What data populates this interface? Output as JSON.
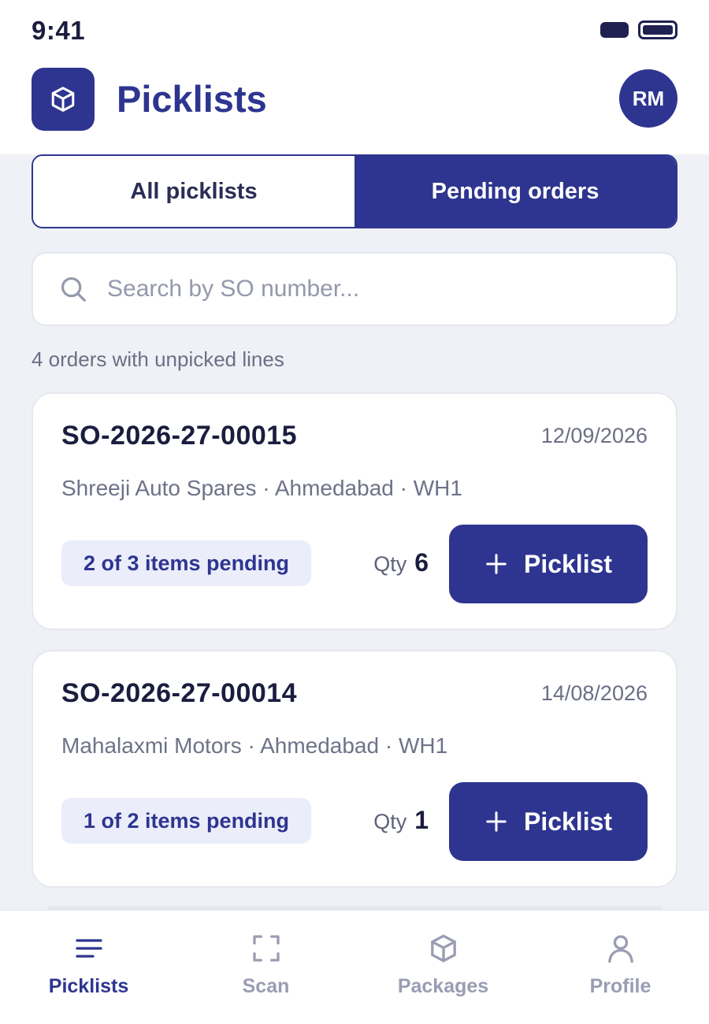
{
  "status_bar": {
    "time": "9:41"
  },
  "header": {
    "title": "Picklists",
    "logo_icon": "package-icon",
    "avatar_initials": "RM"
  },
  "tabs": [
    {
      "label": "All picklists",
      "active": false
    },
    {
      "label": "Pending orders",
      "active": true
    }
  ],
  "search": {
    "placeholder": "Search by SO number...",
    "value": ""
  },
  "summary": {
    "label": "4 orders with unpicked lines"
  },
  "orders": [
    {
      "so_number": "SO-2026-27-00015",
      "date": "12/09/2026",
      "meta": "Shreeji Auto Spares · Ahmedabad · WH1",
      "pending": "2 of 3 items pending",
      "qty_label": "Qty",
      "qty": "6",
      "button_label": "Picklist"
    },
    {
      "so_number": "SO-2026-27-00014",
      "date": "14/08/2026",
      "meta": "Mahalaxmi Motors · Ahmedabad · WH1",
      "pending": "1 of 2 items pending",
      "qty_label": "Qty",
      "qty": "1",
      "button_label": "Picklist"
    }
  ],
  "bottom_nav": [
    {
      "label": "Picklists",
      "icon": "list-icon",
      "active": true
    },
    {
      "label": "Scan",
      "icon": "scan-icon",
      "active": false
    },
    {
      "label": "Packages",
      "icon": "package-icon",
      "active": false
    },
    {
      "label": "Profile",
      "icon": "user-icon",
      "active": false
    }
  ],
  "colors": {
    "primary": "#2e3590",
    "background": "#eff1f6",
    "badge_bg": "#ebeefa",
    "muted": "#9a9db2"
  }
}
